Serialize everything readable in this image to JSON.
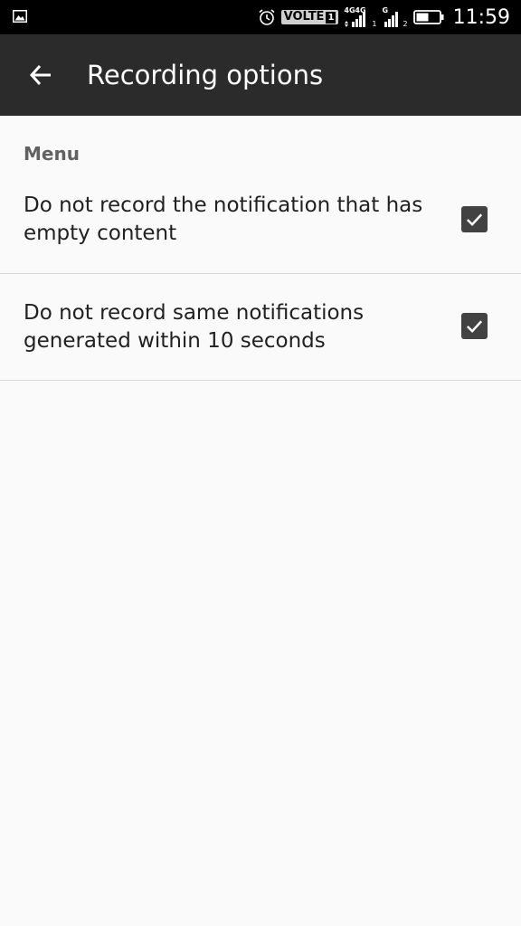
{
  "status_bar": {
    "volte_label": "VOLTE",
    "volte_sim": "1",
    "sim1_network": "4G",
    "sim1_network_b": "4G",
    "sim1_index": "1",
    "sim2_network": "G",
    "sim2_index": "2",
    "time": "11:59",
    "icons": [
      "image-icon",
      "alarm-icon",
      "signal-icon",
      "battery-icon"
    ]
  },
  "app_bar": {
    "title": "Recording options",
    "back_icon": "arrow-back-icon",
    "background": "#2b2b2b"
  },
  "section": {
    "header": "Menu"
  },
  "preferences": [
    {
      "label": "Do not record the notification that has empty content",
      "checked": true
    },
    {
      "label": "Do not record same notifications generated within 10 seconds",
      "checked": true
    }
  ],
  "colors": {
    "checkbox": "#424242",
    "text_primary": "#212121",
    "section_header": "#616161",
    "background": "#fafafa"
  }
}
